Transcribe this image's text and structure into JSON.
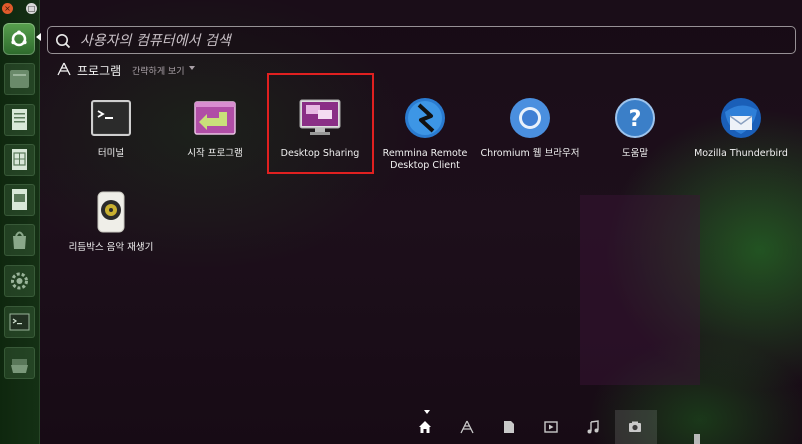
{
  "search": {
    "placeholder": "사용자의 컴퓨터에서 검색",
    "value": ""
  },
  "section": {
    "title": "프로그램",
    "filter_label": "간략하게 보기",
    "icon": "applications-category-icon"
  },
  "apps": [
    {
      "label": "터미널",
      "icon": "terminal-icon"
    },
    {
      "label": "시작 프로그램",
      "icon": "startup-applications-icon"
    },
    {
      "label": "Desktop Sharing",
      "icon": "desktop-sharing-icon",
      "selected": true
    },
    {
      "label": "Remmina Remote Desktop Client",
      "icon": "remmina-icon"
    },
    {
      "label": "Chromium 웹 브라우저",
      "icon": "chromium-icon"
    },
    {
      "label": "도움말",
      "icon": "help-icon"
    },
    {
      "label": "Mozilla Thunderbird",
      "icon": "thunderbird-icon"
    },
    {
      "label": "리듬박스 음악 재생기",
      "icon": "rhythmbox-icon"
    }
  ],
  "launcher": [
    {
      "icon": "files-icon"
    },
    {
      "icon": "writer-icon"
    },
    {
      "icon": "calc-icon"
    },
    {
      "icon": "impress-icon"
    },
    {
      "icon": "software-center-icon"
    },
    {
      "icon": "settings-icon"
    },
    {
      "icon": "terminal-icon"
    },
    {
      "icon": "trash-icon"
    }
  ],
  "lenses": [
    {
      "icon": "home-lens-icon",
      "active": true
    },
    {
      "icon": "applications-lens-icon"
    },
    {
      "icon": "files-lens-icon"
    },
    {
      "icon": "video-lens-icon"
    },
    {
      "icon": "music-lens-icon"
    },
    {
      "icon": "photo-lens-icon"
    }
  ],
  "window_controls": {
    "close_glyph": "×",
    "maximize_glyph": "□"
  }
}
